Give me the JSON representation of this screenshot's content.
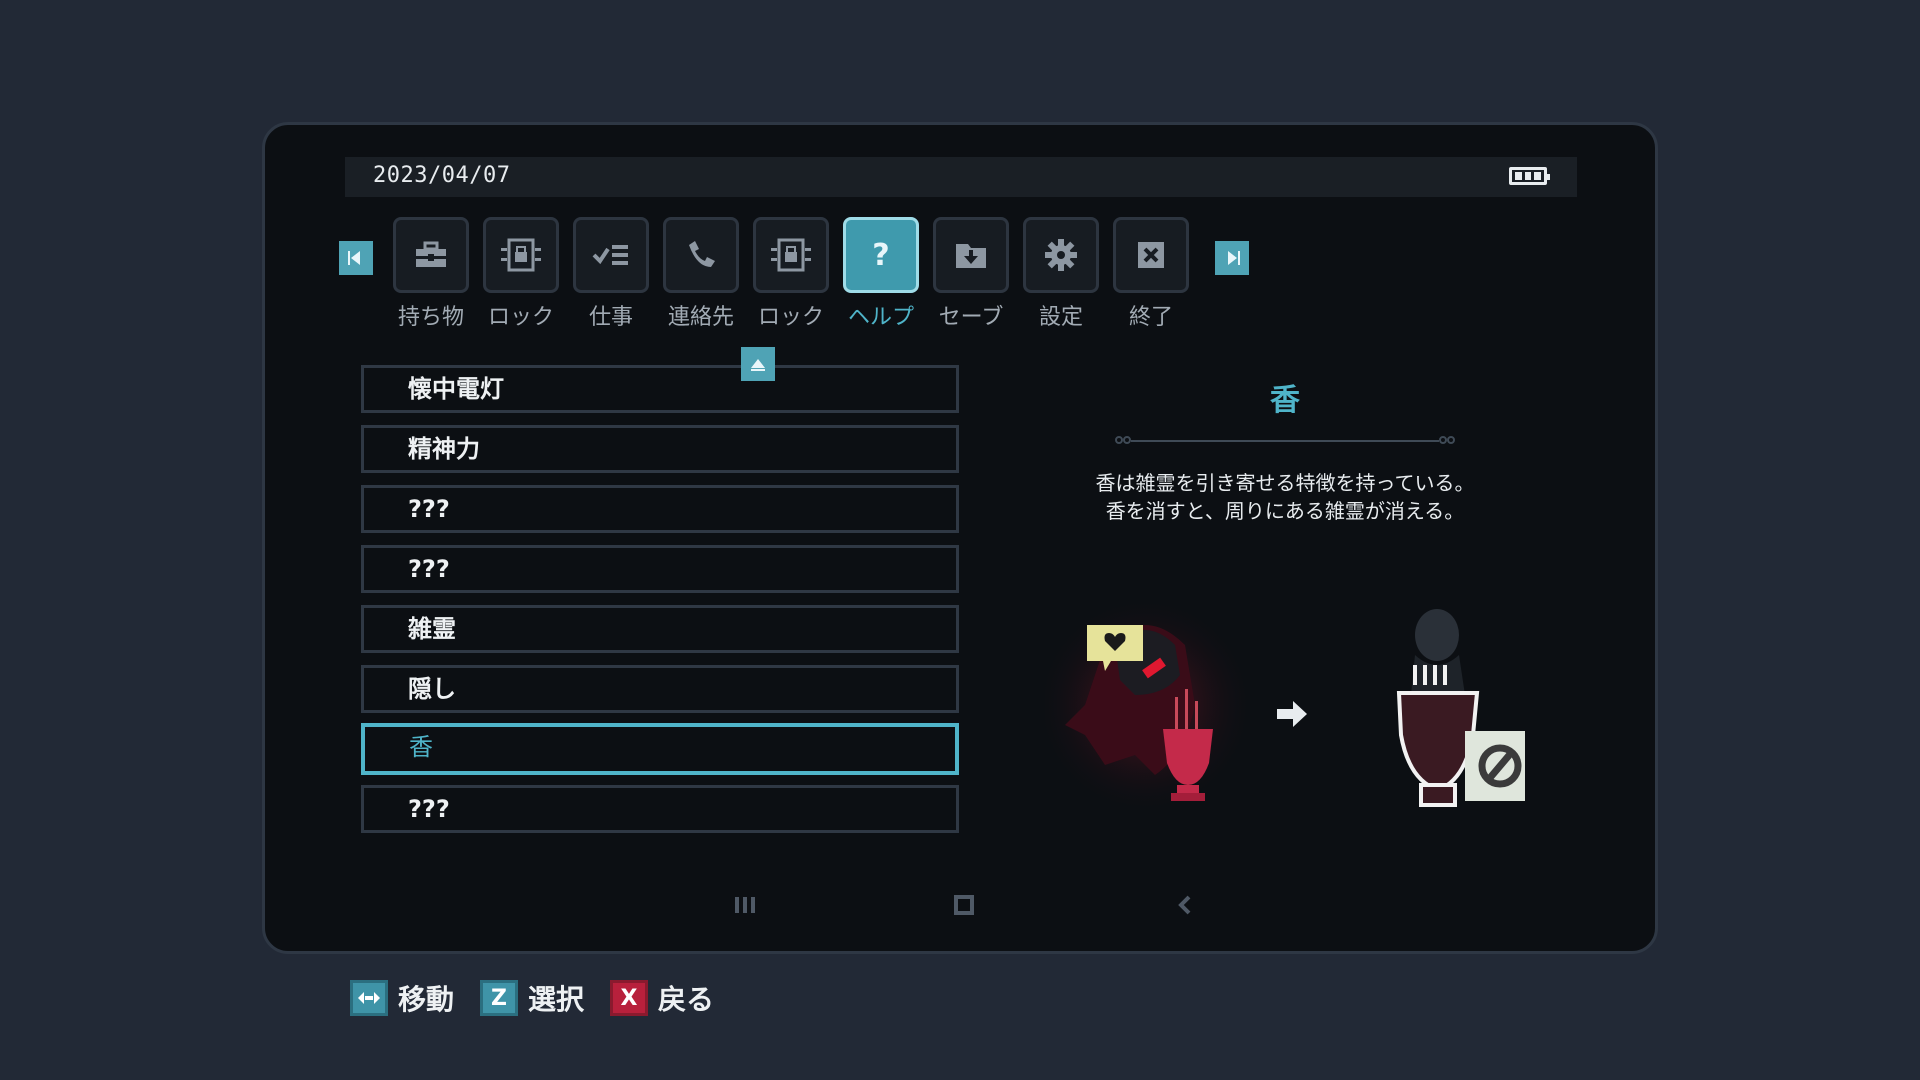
{
  "status": {
    "date": "2023/04/07",
    "battery_icon": "battery-full-icon"
  },
  "tabs": [
    {
      "label": "持ち物",
      "icon": "toolbox-icon",
      "active": false
    },
    {
      "label": "ロック",
      "icon": "lock-device-icon",
      "active": false
    },
    {
      "label": "仕事",
      "icon": "checklist-icon",
      "active": false
    },
    {
      "label": "連絡先",
      "icon": "phone-icon",
      "active": false
    },
    {
      "label": "ロック",
      "icon": "lock-device-icon",
      "active": false
    },
    {
      "label": "ヘルプ",
      "icon": "question-icon",
      "active": true,
      "glyph": "?"
    },
    {
      "label": "セーブ",
      "icon": "save-folder-icon",
      "active": false
    },
    {
      "label": "設定",
      "icon": "gear-icon",
      "active": false
    },
    {
      "label": "終了",
      "icon": "close-icon",
      "active": false
    }
  ],
  "help_list": {
    "items": [
      "懐中電灯",
      "精神力",
      "???",
      "???",
      "雑霊",
      "隠し",
      "香",
      "???"
    ],
    "selected_index": 6
  },
  "detail": {
    "title": "香",
    "description_line1": "香は雑霊を引き寄せる特徴を持っている。",
    "description_line2": "香を消すと、周りにある雑霊が消える。"
  },
  "system_nav": [
    "recent-apps-icon",
    "home-icon",
    "back-icon"
  ],
  "controls": [
    {
      "key": "✥",
      "label": "移動",
      "color": "blue",
      "icon": "dpad-icon"
    },
    {
      "key": "Z",
      "label": "選択",
      "color": "blue"
    },
    {
      "key": "X",
      "label": "戻る",
      "color": "red"
    }
  ],
  "colors": {
    "accent": "#4fb4c9",
    "background": "#222936",
    "screen": "#0c0f13",
    "danger": "#b8203c"
  }
}
